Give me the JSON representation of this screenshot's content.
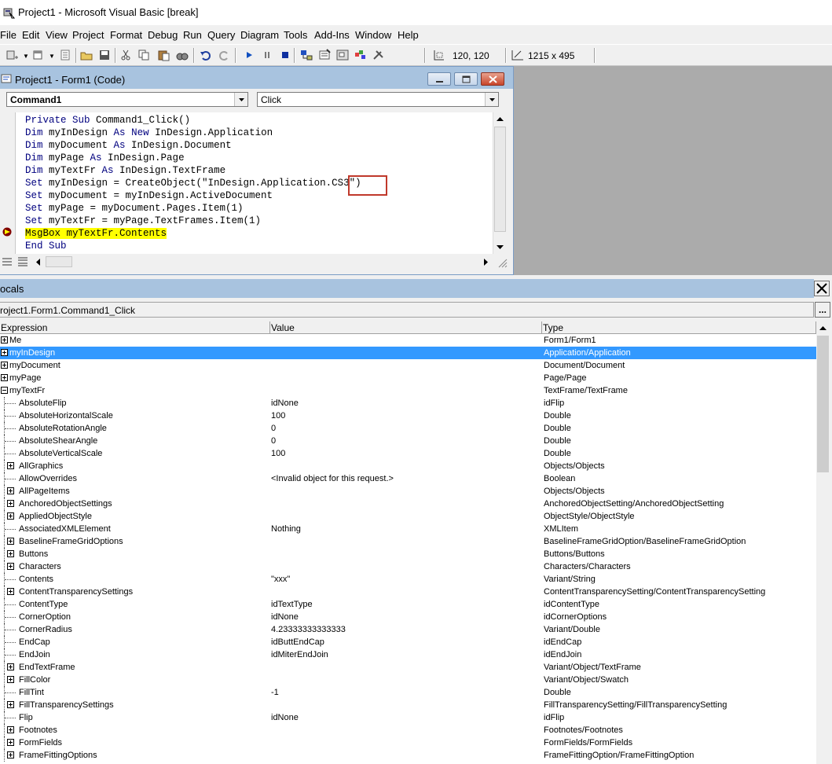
{
  "window": {
    "title": "Project1 - Microsoft Visual Basic [break]"
  },
  "menu": {
    "items": [
      {
        "label": "File"
      },
      {
        "label": "Edit"
      },
      {
        "label": "View"
      },
      {
        "label": "Project"
      },
      {
        "label": "Format"
      },
      {
        "label": "Debug"
      },
      {
        "label": "Run"
      },
      {
        "label": "Query"
      },
      {
        "label": "Diagram"
      },
      {
        "label": "Tools"
      },
      {
        "label": "Add-Ins"
      },
      {
        "label": "Window"
      },
      {
        "label": "Help"
      }
    ]
  },
  "toolbar": {
    "position_readout": "120, 120",
    "size_readout": "1215 x 495"
  },
  "code_window": {
    "title": "Project1 - Form1 (Code)",
    "object_combo": "Command1",
    "proc_combo": "Click",
    "lines": [
      "Private Sub Command1_Click()",
      "Dim myInDesign As New InDesign.Application",
      "Dim myDocument As InDesign.Document",
      "Dim myPage As InDesign.Page",
      "Dim myTextFr As InDesign.TextFrame",
      "Set myInDesign = CreateObject(\"InDesign.Application.CS3\")",
      "Set myDocument = myInDesign.ActiveDocument",
      "Set myPage = myDocument.Pages.Item(1)",
      "Set myTextFr = myPage.TextFrames.Item(1)",
      "MsgBox myTextFr.Contents",
      "End Sub"
    ],
    "current_line_index": 9
  },
  "locals": {
    "title": "ocals",
    "context": "roject1.Form1.Command1_Click",
    "context_button": "...",
    "headers": {
      "expression": "Expression",
      "value": "Value",
      "type": "Type"
    },
    "rows": [
      {
        "expr": "Me",
        "value": "",
        "type": "Form1/Form1",
        "level": 0,
        "expand": "plus"
      },
      {
        "expr": "myInDesign",
        "value": "",
        "type": "Application/Application",
        "level": 0,
        "expand": "plus",
        "selected": true
      },
      {
        "expr": "myDocument",
        "value": "",
        "type": "Document/Document",
        "level": 0,
        "expand": "plus"
      },
      {
        "expr": "myPage",
        "value": "",
        "type": "Page/Page",
        "level": 0,
        "expand": "plus"
      },
      {
        "expr": "myTextFr",
        "value": "",
        "type": "TextFrame/TextFrame",
        "level": 0,
        "expand": "minus"
      },
      {
        "expr": "AbsoluteFlip",
        "value": "idNone",
        "type": "idFlip",
        "level": 1,
        "expand": "none"
      },
      {
        "expr": "AbsoluteHorizontalScale",
        "value": "100",
        "type": "Double",
        "level": 1,
        "expand": "none"
      },
      {
        "expr": "AbsoluteRotationAngle",
        "value": "0",
        "type": "Double",
        "level": 1,
        "expand": "none"
      },
      {
        "expr": "AbsoluteShearAngle",
        "value": "0",
        "type": "Double",
        "level": 1,
        "expand": "none"
      },
      {
        "expr": "AbsoluteVerticalScale",
        "value": "100",
        "type": "Double",
        "level": 1,
        "expand": "none"
      },
      {
        "expr": "AllGraphics",
        "value": "",
        "type": "Objects/Objects",
        "level": 1,
        "expand": "plus"
      },
      {
        "expr": "AllowOverrides",
        "value": "<Invalid object for this request.>",
        "type": "Boolean",
        "level": 1,
        "expand": "none"
      },
      {
        "expr": "AllPageItems",
        "value": "",
        "type": "Objects/Objects",
        "level": 1,
        "expand": "plus"
      },
      {
        "expr": "AnchoredObjectSettings",
        "value": "",
        "type": "AnchoredObjectSetting/AnchoredObjectSetting",
        "level": 1,
        "expand": "plus"
      },
      {
        "expr": "AppliedObjectStyle",
        "value": "",
        "type": "ObjectStyle/ObjectStyle",
        "level": 1,
        "expand": "plus"
      },
      {
        "expr": "AssociatedXMLElement",
        "value": "Nothing",
        "type": "XMLItem",
        "level": 1,
        "expand": "none"
      },
      {
        "expr": "BaselineFrameGridOptions",
        "value": "",
        "type": "BaselineFrameGridOption/BaselineFrameGridOption",
        "level": 1,
        "expand": "plus"
      },
      {
        "expr": "Buttons",
        "value": "",
        "type": "Buttons/Buttons",
        "level": 1,
        "expand": "plus"
      },
      {
        "expr": "Characters",
        "value": "",
        "type": "Characters/Characters",
        "level": 1,
        "expand": "plus"
      },
      {
        "expr": "Contents",
        "value": "\"xxx\"",
        "type": "Variant/String",
        "level": 1,
        "expand": "none"
      },
      {
        "expr": "ContentTransparencySettings",
        "value": "",
        "type": "ContentTransparencySetting/ContentTransparencySetting",
        "level": 1,
        "expand": "plus"
      },
      {
        "expr": "ContentType",
        "value": "idTextType",
        "type": "idContentType",
        "level": 1,
        "expand": "none"
      },
      {
        "expr": "CornerOption",
        "value": "idNone",
        "type": "idCornerOptions",
        "level": 1,
        "expand": "none"
      },
      {
        "expr": "CornerRadius",
        "value": "4.23333333333333",
        "type": "Variant/Double",
        "level": 1,
        "expand": "none"
      },
      {
        "expr": "EndCap",
        "value": "idButtEndCap",
        "type": "idEndCap",
        "level": 1,
        "expand": "none"
      },
      {
        "expr": "EndJoin",
        "value": "idMiterEndJoin",
        "type": "idEndJoin",
        "level": 1,
        "expand": "none"
      },
      {
        "expr": "EndTextFrame",
        "value": "",
        "type": "Variant/Object/TextFrame",
        "level": 1,
        "expand": "plus"
      },
      {
        "expr": "FillColor",
        "value": "",
        "type": "Variant/Object/Swatch",
        "level": 1,
        "expand": "plus"
      },
      {
        "expr": "FillTint",
        "value": "-1",
        "type": "Double",
        "level": 1,
        "expand": "none"
      },
      {
        "expr": "FillTransparencySettings",
        "value": "",
        "type": "FillTransparencySetting/FillTransparencySetting",
        "level": 1,
        "expand": "plus"
      },
      {
        "expr": "Flip",
        "value": "idNone",
        "type": "idFlip",
        "level": 1,
        "expand": "none"
      },
      {
        "expr": "Footnotes",
        "value": "",
        "type": "Footnotes/Footnotes",
        "level": 1,
        "expand": "plus"
      },
      {
        "expr": "FormFields",
        "value": "",
        "type": "FormFields/FormFields",
        "level": 1,
        "expand": "plus"
      },
      {
        "expr": "FrameFittingOptions",
        "value": "",
        "type": "FrameFittingOption/FrameFittingOption",
        "level": 1,
        "expand": "plus"
      }
    ]
  },
  "colors": {
    "keyword": "#00007f",
    "current_line_highlight": "#ffff00",
    "selection": "#3399ff",
    "titlebar_active": "#a8c3df",
    "annotation_box": "#c0392b"
  }
}
